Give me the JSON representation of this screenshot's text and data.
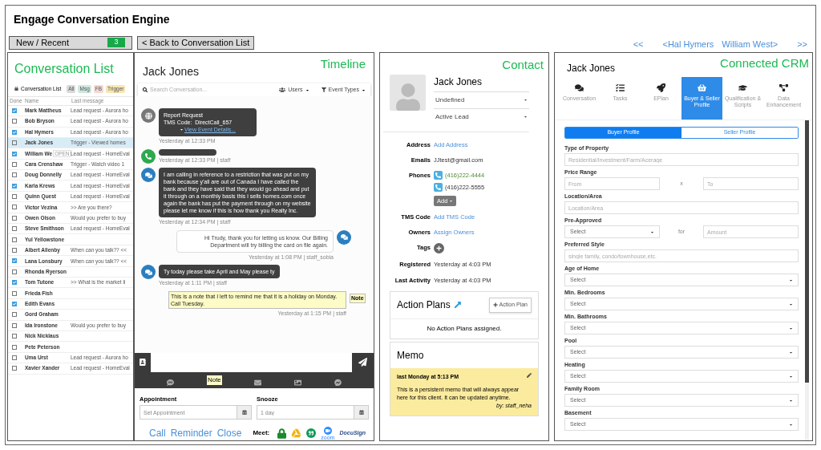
{
  "app_title": "Engage Conversation Engine",
  "toolbar": {
    "new_recent": {
      "label": "New / Recent",
      "count": "3"
    },
    "back": "< Back to Conversation List",
    "nav": [
      "<<",
      "<Hal Hymers",
      "William West>",
      ">>"
    ]
  },
  "conversation_list": {
    "title": "Conversation List",
    "view": "Conversation List",
    "filters": [
      {
        "label": "All",
        "color": "#d9d9d9"
      },
      {
        "label": "Msg",
        "color": "#cfe8df"
      },
      {
        "label": "FB",
        "color": "#f3d9d4"
      },
      {
        "label": "Trigger",
        "color": "#f7e7b4"
      }
    ],
    "columns": [
      "Done",
      "Name",
      "Last message"
    ],
    "rows": [
      {
        "name": "Mark Mattheus",
        "message": "Lead request - Aurora ho",
        "checked": true,
        "selected": false
      },
      {
        "name": "Bob Bryson",
        "message": "Lead request - Aurora ho",
        "checked": false,
        "selected": false
      },
      {
        "name": "Hal Hymers",
        "message": "Lead request - Aurora ho",
        "checked": true,
        "selected": false
      },
      {
        "name": "Jack Jones",
        "message": "Trigger - Viewed homes",
        "checked": false,
        "selected": true
      },
      {
        "name": "William We",
        "badge": "OPEN",
        "message": "Lead request - HomeEval",
        "checked": true,
        "selected": false
      },
      {
        "name": "Cara Crenshaw",
        "message": "Trigger - Watch video 1",
        "checked": false,
        "selected": false
      },
      {
        "name": "Doug Donnelly",
        "message": "Lead request - HomeEval",
        "checked": false,
        "selected": false
      },
      {
        "name": "Karla Krews",
        "message": "Lead request - HomeEval",
        "checked": true,
        "selected": false
      },
      {
        "name": "Quinn Quest",
        "message": "Lead request - HomeEval",
        "checked": false,
        "selected": false
      },
      {
        "name": "Victor Vezina",
        "message": ">> Are you there?",
        "checked": false,
        "selected": false
      },
      {
        "name": "Owen Olson",
        "message": "Would you prefer to buy",
        "checked": false,
        "selected": false
      },
      {
        "name": "Steve Smithson",
        "message": "Lead request - HomeEval",
        "checked": false,
        "selected": false
      },
      {
        "name": "Yul Yellowstone",
        "checked": false,
        "selected": false
      },
      {
        "name": "Albert Allenby",
        "message": "When can you talk?? <<",
        "checked": false,
        "selected": false
      },
      {
        "name": "Lana Lonsbury",
        "message": "When can you talk?? <<",
        "checked": true,
        "selected": false
      },
      {
        "name": "Rhonda Ryerson",
        "checked": false,
        "selected": false
      },
      {
        "name": "Tom Tutone",
        "message": ">> What is the market li",
        "checked": true,
        "selected": false
      },
      {
        "name": "Frieda Fish",
        "checked": false,
        "selected": false
      },
      {
        "name": "Edith Evans",
        "checked": true,
        "selected": false
      },
      {
        "name": "Gord Graham",
        "checked": false,
        "selected": false
      },
      {
        "name": "Ida Ironstone",
        "message": "Would you prefer to buy",
        "checked": false,
        "selected": false
      },
      {
        "name": "Nick Nicklaus",
        "checked": false,
        "selected": false
      },
      {
        "name": "Pete Peterson",
        "checked": false,
        "selected": false
      },
      {
        "name": "Uma Urst",
        "message": "Lead request - Aurora ho",
        "checked": false,
        "selected": false
      },
      {
        "name": "Xavier Xander",
        "message": "Lead request - HomeEval",
        "checked": false,
        "selected": false
      }
    ]
  },
  "timeline": {
    "title": "Timeline",
    "contact": "Jack Jones",
    "search_placeholder": "Search Conversation...",
    "users": "Users",
    "event_types": "Event Types",
    "events": [
      {
        "kind": "event",
        "lines": [
          "Report Request",
          "TMS Code:  DirectCall_657"
        ],
        "link": "View Event Details...",
        "meta": "Yesterday at 12:33 PM"
      },
      {
        "kind": "call",
        "meta": "Yesterday at 12:33 PM | staff"
      },
      {
        "kind": "incoming",
        "text": "I am calling in reference to a restriction that was put on my bank because y'all are out of Canada I have called the bank and they have said that they would go ahead and put it through on a monthly basis this i sells homes.com once again the bank has put the payment through on my website please let me know if this is how thank you Realty Inc.",
        "meta": "Yesterday at 12:34 PM | staff"
      },
      {
        "kind": "outgoing",
        "text": "Hi Trudy, thank you for letting us know. Our Billing Department will try billing the card on file again.",
        "meta": "Yesterday at 1:08 PM | staff_sobia"
      },
      {
        "kind": "incoming",
        "text": "Ty today please take April and May please ty",
        "meta": "Yesterday at 1:11 PM | staff"
      },
      {
        "kind": "note",
        "text": "This is a note that I left to remind me that it is a holiday on Monday. Call Tuesday.",
        "tag": "Note",
        "meta": "Yesterday at 1:15 PM | staff"
      }
    ],
    "composer_channels": [
      {
        "selected": false
      },
      {
        "label": "Note",
        "selected": true
      },
      {
        "selected": false
      },
      {
        "selected": false
      },
      {
        "selected": false
      }
    ],
    "appointment": {
      "label": "Appointment",
      "placeholder": "Set Appointment"
    },
    "snooze": {
      "label": "Snooze",
      "placeholder": "1 day"
    },
    "actions": [
      "Call",
      "Reminder",
      "Close"
    ],
    "meet": {
      "label": "Meet:",
      "apps": [
        {
          "kind": "lock"
        },
        {
          "kind": "drive"
        },
        {
          "kind": "hangouts"
        },
        {
          "kind": "zoom",
          "label": "zoom"
        },
        {
          "kind": "docusign",
          "label": "DocuSign"
        }
      ]
    }
  },
  "contact": {
    "title": "Contact",
    "name": "Jack Jones",
    "type": "Undefined",
    "status": "Active Lead",
    "fields": [
      {
        "kind": "link",
        "label": "Address",
        "value": "Add Address"
      },
      {
        "kind": "text",
        "label": "Emails",
        "value": "JJtest@gmail.com"
      },
      {
        "kind": "phones",
        "label": "Phones",
        "phones": [
          {
            "number": "(416)222-4444",
            "primary": true
          },
          {
            "number": "(416)222-5555",
            "primary": false
          }
        ],
        "add": "Add"
      },
      {
        "kind": "link",
        "label": "TMS Code",
        "value": "Add TMS Code"
      },
      {
        "kind": "link",
        "label": "Owners",
        "value": "Assign Owners"
      },
      {
        "kind": "add",
        "label": "Tags"
      },
      {
        "kind": "text",
        "label": "Registered",
        "value": "Yesterday at 4:03 PM"
      },
      {
        "kind": "text",
        "label": "Last Activity",
        "value": "Yesterday at 4:03 PM"
      }
    ],
    "action_plans": {
      "title": "Action Plans",
      "button": "Action Plan",
      "empty": "No Action Plans assigned."
    },
    "memo": {
      "title": "Memo",
      "date": "last Monday at 5:13 PM",
      "text": "This is a persistent memo that will always appear here for this client. It can be updated anytime.",
      "author": "by: staff_neha"
    }
  },
  "crm": {
    "title": "Connected CRM",
    "contact": "Jack Jones",
    "tabs": [
      {
        "label": "Conversation",
        "selected": false
      },
      {
        "label": "Tasks",
        "selected": false
      },
      {
        "label": "EPlan",
        "selected": false
      },
      {
        "label": "Buyer & Seller Profile",
        "selected": true
      },
      {
        "label": "Qualification & Scripts",
        "selected": false
      },
      {
        "label": "Data Enhancement",
        "selected": false
      }
    ],
    "profiles": [
      {
        "label": "Buyer Profile",
        "selected": true
      },
      {
        "label": "Seller Profile",
        "selected": false
      }
    ],
    "form": [
      {
        "kind": "text",
        "label": "Type of Property",
        "placeholder": "Residential/Investment/Farm/Acerage"
      },
      {
        "kind": "range",
        "label": "Price Range",
        "placeholder_from": "From",
        "sep": "x",
        "placeholder_to": "To"
      },
      {
        "kind": "text",
        "label": "Location/Area",
        "placeholder": "Location/Area"
      },
      {
        "kind": "select_amount",
        "label": "Pre-Approved",
        "value": "Select",
        "sep": "for",
        "placeholder": "Amount"
      },
      {
        "kind": "text",
        "label": "Preferred Style",
        "placeholder": "single family, condo/townhouse,etc."
      },
      {
        "kind": "select",
        "label": "Age of Home",
        "value": "Select"
      },
      {
        "kind": "select",
        "label": "Min. Bedrooms",
        "value": "Select"
      },
      {
        "kind": "select",
        "label": "Min. Bathrooms",
        "value": "Select"
      },
      {
        "kind": "select",
        "label": "Pool",
        "value": "Select"
      },
      {
        "kind": "select",
        "label": "Heating",
        "value": "Select"
      },
      {
        "kind": "select",
        "label": "Family Room",
        "value": "Select"
      },
      {
        "kind": "select",
        "label": "Basement",
        "value": "Select"
      }
    ]
  }
}
